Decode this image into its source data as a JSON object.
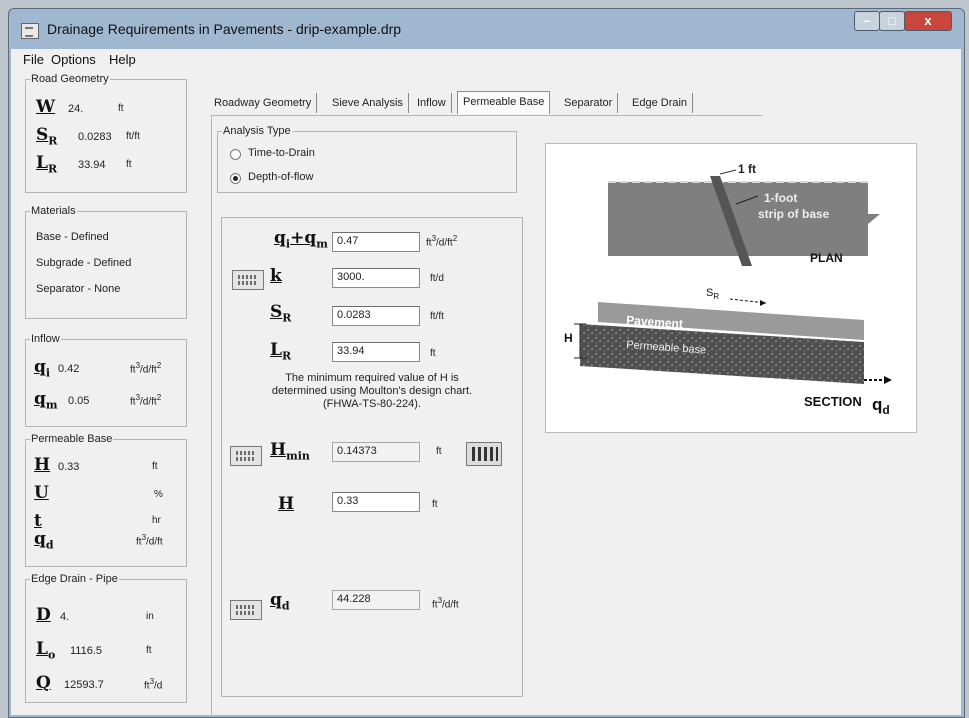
{
  "window": {
    "title": "Drainage Requirements in Pavements - drip-example.drp",
    "controls": {
      "minimize": "–",
      "maximize": "□",
      "close": "x"
    }
  },
  "menu": [
    "File",
    "Options",
    "Help"
  ],
  "road_geometry": {
    "legend": "Road Geometry",
    "rows": [
      {
        "sym": "W",
        "sub": "",
        "value": "24.",
        "unit": "ft"
      },
      {
        "sym": "S",
        "sub": "R",
        "value": "0.0283",
        "unit": "ft/ft"
      },
      {
        "sym": "L",
        "sub": "R",
        "value": "33.94",
        "unit": "ft"
      }
    ]
  },
  "materials": {
    "legend": "Materials",
    "items": [
      "Base - Defined",
      "Subgrade - Defined",
      "Separator - None"
    ]
  },
  "inflow": {
    "legend": "Inflow",
    "rows": [
      {
        "sym": "q",
        "sub": "i",
        "value": "0.42",
        "unit_pre": "ft",
        "unit_sup": "3",
        "unit_mid": "/d/ft",
        "unit_sup2": "2"
      },
      {
        "sym": "q",
        "sub": "m",
        "value": "0.05",
        "unit_pre": "ft",
        "unit_sup": "3",
        "unit_mid": "/d/ft",
        "unit_sup2": "2"
      }
    ]
  },
  "permeable_base": {
    "legend": "Permeable Base",
    "rows": [
      {
        "sym": "H",
        "sub": "",
        "value": "0.33",
        "unit": "ft"
      },
      {
        "sym": "U",
        "sub": "",
        "value": "",
        "unit": "%"
      },
      {
        "sym": "t",
        "sub": "",
        "value": "",
        "unit": "hr"
      },
      {
        "sym": "q",
        "sub": "d",
        "value": "",
        "unit_pre": "ft",
        "unit_sup": "3",
        "unit_mid": "/d/ft"
      }
    ]
  },
  "edge_drain": {
    "legend": "Edge Drain - Pipe",
    "rows": [
      {
        "sym": "D",
        "sub": "",
        "value": "4.",
        "unit": "in"
      },
      {
        "sym": "L",
        "sub": "o",
        "value": "1116.5",
        "unit": "ft"
      },
      {
        "sym": "Q",
        "sub": "",
        "value": "12593.7",
        "unit_pre": "ft",
        "unit_sup": "3",
        "unit_mid": "/d"
      }
    ]
  },
  "tabs": [
    {
      "label": "Roadway Geometry",
      "active": false
    },
    {
      "label": "Sieve Analysis",
      "active": false
    },
    {
      "label": "Inflow",
      "active": false
    },
    {
      "label": "Permeable Base",
      "active": true
    },
    {
      "label": "Separator",
      "active": false
    },
    {
      "label": "Edge Drain",
      "active": false
    }
  ],
  "analysis_type": {
    "legend": "Analysis Type",
    "options": [
      {
        "label": "Time-to-Drain",
        "selected": false
      },
      {
        "label": "Depth-of-flow",
        "selected": true
      }
    ]
  },
  "form": {
    "qiqm": {
      "label_q1": "q",
      "label_s1": "i",
      "label_plus": "+",
      "label_q2": "q",
      "label_s2": "m",
      "value": "0.47",
      "unit_pre": "ft",
      "unit_sup": "3",
      "unit_mid": "/d/ft",
      "unit_sup2": "2"
    },
    "k": {
      "label": "k",
      "value": "3000.",
      "unit": "ft/d"
    },
    "sr": {
      "label": "S",
      "sub": "R",
      "value": "0.0283",
      "unit": "ft/ft"
    },
    "lr": {
      "label": "L",
      "sub": "R",
      "value": "33.94",
      "unit": "ft"
    },
    "note": [
      "The minimum required value of H is",
      "determined using Moulton's design chart.",
      "(FHWA-TS-80-224)."
    ],
    "hmin": {
      "label": "H",
      "sub": "min",
      "value": "0.14373",
      "unit": "ft"
    },
    "h": {
      "label": "H",
      "value": "0.33",
      "unit": "ft"
    },
    "qd": {
      "label": "q",
      "sub": "d",
      "value": "44.228",
      "unit_pre": "ft",
      "unit_sup": "3",
      "unit_mid": "/d/ft"
    }
  },
  "diagram": {
    "width_label": "1 ft",
    "strip_label_1": "1-foot",
    "strip_label_2": "strip of base",
    "plan_label": "PLAN",
    "slope_label": "S",
    "slope_sub": "R",
    "pavement_label": "Pavement",
    "base_label": "Permeable base",
    "h_label": "H",
    "section_label": "SECTION",
    "qd_label": "q",
    "qd_sub": "d"
  }
}
